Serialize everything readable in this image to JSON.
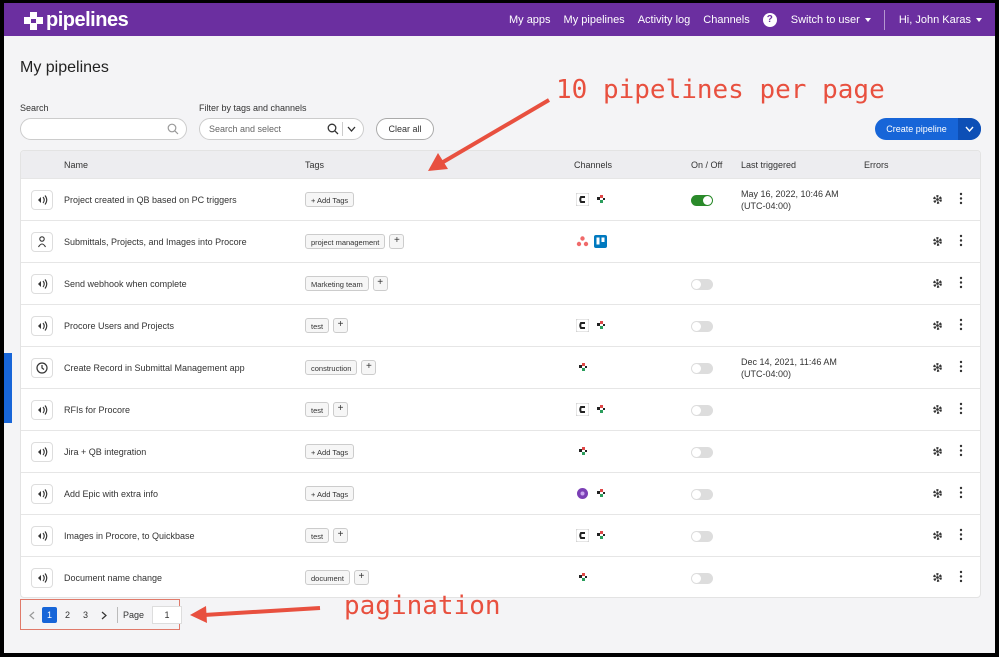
{
  "topbar": {
    "logo_text": "pipelines",
    "nav_items": [
      "My apps",
      "My pipelines",
      "Activity log",
      "Channels"
    ],
    "help_label": "?",
    "switch_user": "Switch to user",
    "greeting": "Hi, John Karas"
  },
  "page": {
    "title": "My pipelines",
    "search_label": "Search",
    "filter_label": "Filter by tags and channels",
    "filter_placeholder": "Search and select",
    "clear_all": "Clear all",
    "create_pipeline": "Create pipeline"
  },
  "table": {
    "columns": {
      "name": "Name",
      "tags": "Tags",
      "channels": "Channels",
      "onoff": "On / Off",
      "last_triggered": "Last triggered",
      "errors": "Errors"
    },
    "rows": [
      {
        "name": "Project created in QB based on PC triggers",
        "icon": "webhook-icon",
        "tag": "+ Add Tags",
        "has_tag_plus": false,
        "channels": [
          "procore",
          "quickbase"
        ],
        "on": true,
        "time1": "May 16, 2022, 10:46 AM",
        "time2": "(UTC-04:00)"
      },
      {
        "name": "Submittals, Projects, and Images into Procore",
        "icon": "person-icon",
        "tag": "project management",
        "has_tag_plus": true,
        "channels": [
          "asana",
          "trello"
        ],
        "on": null,
        "time1": "",
        "time2": ""
      },
      {
        "name": "Send webhook when complete",
        "icon": "webhook-icon",
        "tag": "Marketing team",
        "has_tag_plus": true,
        "channels": [],
        "on": false,
        "time1": "",
        "time2": ""
      },
      {
        "name": "Procore Users and Projects",
        "icon": "webhook-icon",
        "tag": "test",
        "has_tag_plus": true,
        "channels": [
          "procore",
          "quickbase"
        ],
        "on": false,
        "time1": "",
        "time2": ""
      },
      {
        "name": "Create Record in Submittal Management app",
        "icon": "clock-icon",
        "tag": "construction",
        "has_tag_plus": true,
        "channels": [
          "quickbase"
        ],
        "on": false,
        "time1": "Dec 14, 2021, 11:46 AM",
        "time2": "(UTC-04:00)"
      },
      {
        "name": "RFIs for Procore",
        "icon": "webhook-icon",
        "tag": "test",
        "has_tag_plus": true,
        "channels": [
          "procore",
          "quickbase"
        ],
        "on": false,
        "time1": "",
        "time2": ""
      },
      {
        "name": "Jira + QB integration",
        "icon": "webhook-icon",
        "tag": "+ Add Tags",
        "has_tag_plus": false,
        "channels": [
          "quickbase"
        ],
        "on": false,
        "time1": "",
        "time2": ""
      },
      {
        "name": "Add Epic with extra info",
        "icon": "webhook-icon",
        "tag": "+ Add Tags",
        "has_tag_plus": false,
        "channels": [
          "epic",
          "quickbase"
        ],
        "on": false,
        "time1": "",
        "time2": ""
      },
      {
        "name": "Images in Procore, to Quickbase",
        "icon": "webhook-icon",
        "tag": "test",
        "has_tag_plus": true,
        "channels": [
          "procore",
          "quickbase"
        ],
        "on": false,
        "time1": "",
        "time2": ""
      },
      {
        "name": "Document name change",
        "icon": "webhook-icon",
        "tag": "document",
        "has_tag_plus": true,
        "channels": [
          "quickbase"
        ],
        "on": false,
        "time1": "",
        "time2": ""
      }
    ]
  },
  "pagination": {
    "pages": [
      "1",
      "2",
      "3"
    ],
    "active": "1",
    "page_label": "Page",
    "page_value": "1"
  },
  "annotations": {
    "per_page": "10 pipelines per page",
    "pagination": "pagination"
  },
  "colors": {
    "brand_purple": "#6b2fa0",
    "primary_blue": "#1765d8",
    "toggle_on": "#2a8a2a",
    "annotation_red": "#e8503f"
  }
}
